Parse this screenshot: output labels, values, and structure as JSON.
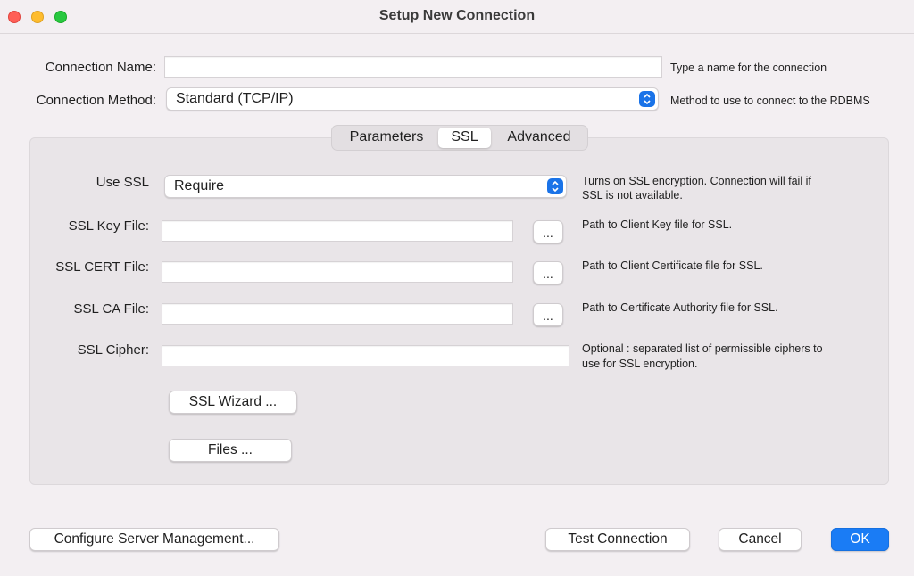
{
  "window": {
    "title": "Setup New Connection"
  },
  "form": {
    "connection_name_label": "Connection Name:",
    "connection_name_value": "",
    "connection_name_hint": "Type a name for the connection",
    "connection_method_label": "Connection Method:",
    "connection_method_value": "Standard (TCP/IP)",
    "connection_method_hint": "Method to use to connect to the RDBMS"
  },
  "tabs": [
    {
      "label": "Parameters",
      "active": false
    },
    {
      "label": "SSL",
      "active": true
    },
    {
      "label": "Advanced",
      "active": false
    }
  ],
  "ssl": {
    "use_ssl_label": "Use SSL",
    "use_ssl_value": "Require",
    "use_ssl_hint_1": "Turns on SSL encryption. Connection will fail if",
    "use_ssl_hint_2": "SSL is not available.",
    "key_file_label": "SSL Key File:",
    "key_file_hint": "Path to Client Key file for SSL.",
    "cert_file_label": "SSL CERT File:",
    "cert_file_hint": "Path to Client Certificate file for SSL.",
    "ca_file_label": "SSL CA File:",
    "ca_file_hint": "Path to Certificate Authority file for SSL.",
    "cipher_label": "SSL Cipher:",
    "cipher_hint_1": "Optional : separated list of permissible ciphers to",
    "cipher_hint_2": "use for SSL encryption.",
    "browse_label": "...",
    "wizard_button": "SSL Wizard ...",
    "files_button": "Files ..."
  },
  "footer": {
    "configure_button": "Configure Server Management...",
    "test_button": "Test Connection",
    "cancel_button": "Cancel",
    "ok_button": "OK"
  },
  "colors": {
    "accent": "#1a7cf5",
    "window_bg": "#f3eff2",
    "panel_bg": "#e9e5e8"
  }
}
